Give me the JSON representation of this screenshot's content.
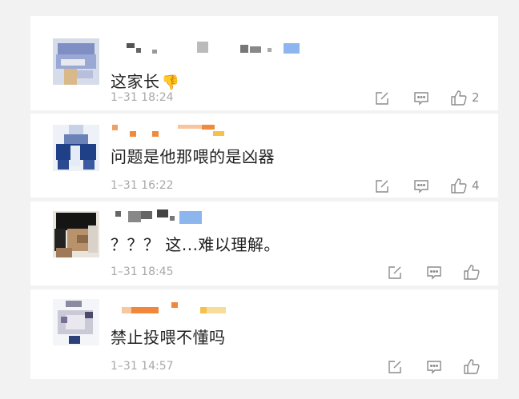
{
  "comments": [
    {
      "text": "这家长",
      "emoji": "👎",
      "time": "1–31 18:24",
      "likes": "2",
      "icons": {
        "share": "share-icon",
        "reply": "comment-icon",
        "like": "thumb-up-icon"
      }
    },
    {
      "text": "问题是他那喂的是凶器",
      "emoji": "",
      "time": "1–31 16:22",
      "likes": "4",
      "icons": {
        "share": "share-icon",
        "reply": "comment-icon",
        "like": "thumb-up-icon"
      }
    },
    {
      "text": "？？？ 这...难以理解。",
      "emoji": "",
      "time": "1–31 18:45",
      "likes": "",
      "icons": {
        "share": "share-icon",
        "reply": "comment-icon",
        "like": "thumb-up-icon"
      }
    },
    {
      "text": "禁止投喂不懂吗",
      "emoji": "",
      "time": "1–31 14:57",
      "likes": "",
      "icons": {
        "share": "share-icon",
        "reply": "comment-icon",
        "like": "thumb-up-icon"
      }
    }
  ],
  "colors": {
    "background": "#f2f2f2",
    "card": "#ffffff",
    "text": "#222222",
    "muted": "#a8a8a8",
    "icon": "#8c8c8c"
  }
}
